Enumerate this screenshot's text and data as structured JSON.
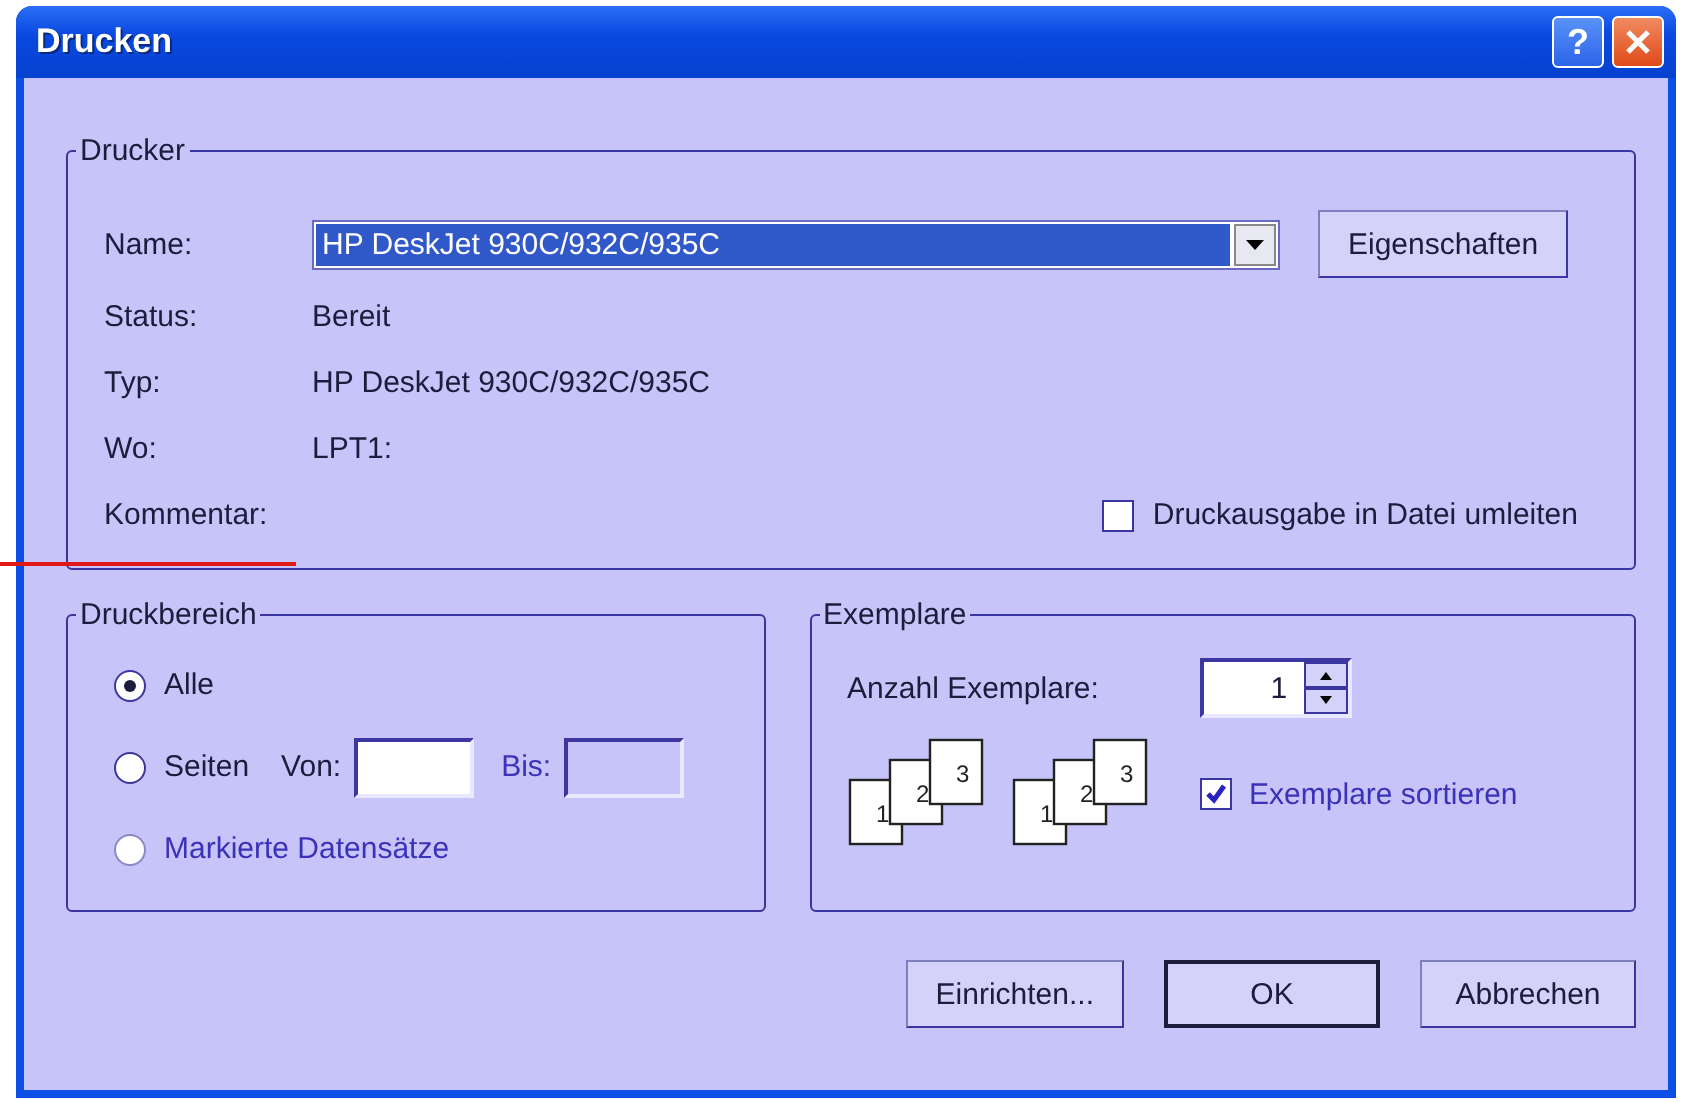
{
  "window": {
    "title": "Drucken",
    "help": "?"
  },
  "printer": {
    "legend": "Drucker",
    "name_label": "Name:",
    "name_value": "HP DeskJet 930C/932C/935C",
    "properties_button": "Eigenschaften",
    "info": [
      {
        "label": "Status:",
        "value": "Bereit"
      },
      {
        "label": "Typ:",
        "value": "HP DeskJet 930C/932C/935C"
      },
      {
        "label": "Wo:",
        "value": "LPT1:"
      },
      {
        "label": "Kommentar:"
      }
    ],
    "print_to_file": {
      "label": "Druckausgabe in Datei umleiten",
      "checked": false
    }
  },
  "range": {
    "legend": "Druckbereich",
    "options": [
      {
        "kind": "plain",
        "label": "Alle",
        "selected": true,
        "disabled": false
      },
      {
        "kind": "pages",
        "label": "Seiten",
        "selected": false,
        "disabled": false,
        "fields": [
          {
            "label": "Von:",
            "disabled": false
          },
          {
            "label": "Bis:",
            "disabled": true
          }
        ]
      },
      {
        "kind": "plain",
        "label": "Markierte Datensätze",
        "selected": false,
        "disabled": true
      }
    ]
  },
  "copies": {
    "legend": "Exemplare",
    "count_label": "Anzahl Exemplare:",
    "count": "1",
    "stacks": [
      [
        "1",
        "2",
        "3"
      ],
      [
        "1",
        "2",
        "3"
      ]
    ],
    "collate": {
      "label": "Exemplare sortieren",
      "checked": true
    }
  },
  "buttons": [
    {
      "label": "Einrichten...",
      "default": false
    },
    {
      "label": "OK",
      "default": true
    },
    {
      "label": "Abbrechen",
      "default": false
    }
  ]
}
